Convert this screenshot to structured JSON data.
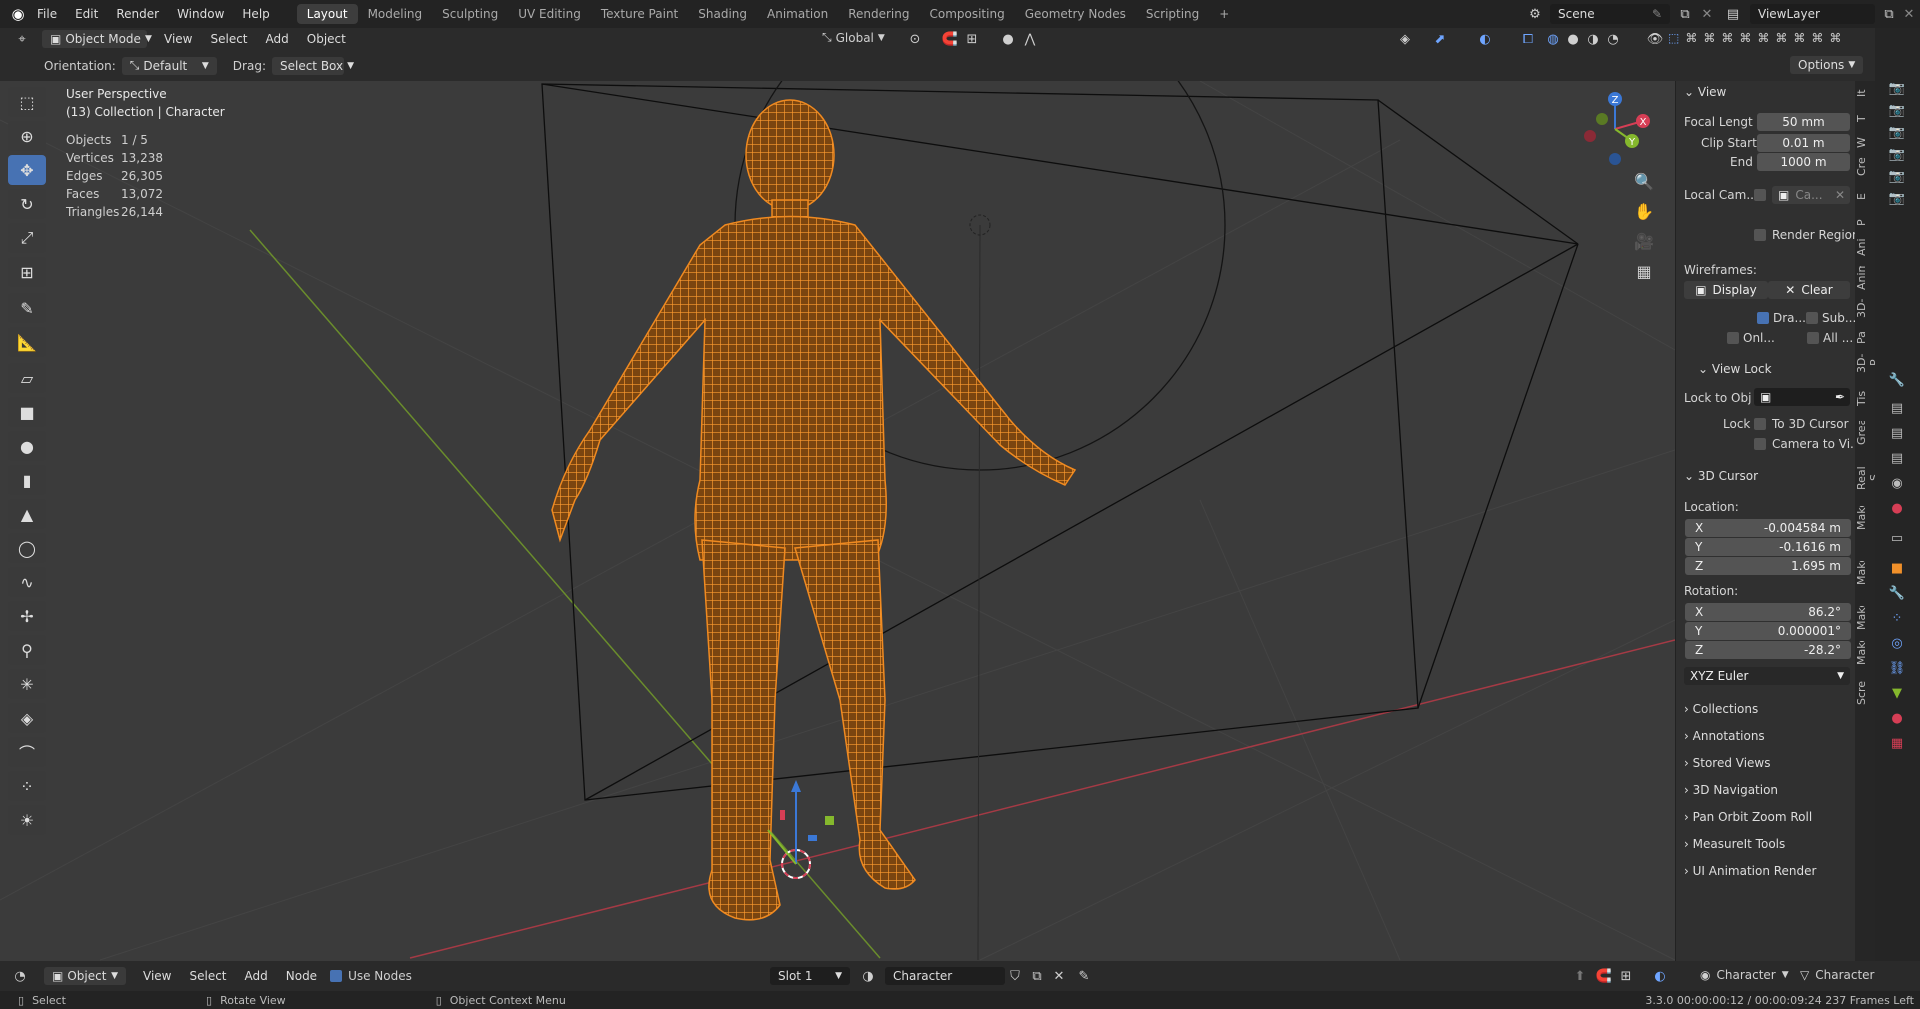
{
  "topbar": {
    "menus": [
      "File",
      "Edit",
      "Render",
      "Window",
      "Help"
    ],
    "workspaces": [
      "Layout",
      "Modeling",
      "Sculpting",
      "UV Editing",
      "Texture Paint",
      "Shading",
      "Animation",
      "Rendering",
      "Compositing",
      "Geometry Nodes",
      "Scripting"
    ],
    "add_tab": "+",
    "scene": "Scene",
    "view_layer": "ViewLayer"
  },
  "header": {
    "mode": "Object Mode",
    "menus": [
      "View",
      "Select",
      "Add",
      "Object"
    ],
    "transform_orientation": "Global",
    "options": "Options"
  },
  "tool_settings": {
    "orientation_label": "Orientation:",
    "orientation_value": "Default",
    "drag_label": "Drag:",
    "drag_value": "Select Box"
  },
  "hud": {
    "view_name": "User Perspective",
    "context": "(13) Collection | Character",
    "stats": [
      {
        "label": "Objects",
        "value": "1 / 5"
      },
      {
        "label": "Vertices",
        "value": "13,238"
      },
      {
        "label": "Edges",
        "value": "26,305"
      },
      {
        "label": "Faces",
        "value": "13,072"
      },
      {
        "label": "Triangles",
        "value": "26,144"
      }
    ]
  },
  "gizmo": {
    "x": "X",
    "y": "Y",
    "z": "Z"
  },
  "npanel": {
    "view_header": "View",
    "focal_label": "Focal Lengt",
    "focal_value": "50 mm",
    "clip_start_label": "Clip Start",
    "clip_start_value": "0.01 m",
    "clip_end_label": "End",
    "clip_end_value": "1000 m",
    "local_cam_label": "Local Cam...",
    "local_cam_value": "Ca...",
    "render_region": "Render Region",
    "wireframes_label": "Wireframes:",
    "display_btn": "Display",
    "clear_btn": "Clear",
    "cb_dra": "Dra...",
    "cb_sub": "Sub...",
    "cb_onl": "Onl...",
    "cb_all": "All ...",
    "view_lock_header": "View Lock",
    "lock_to_obj": "Lock to Obj",
    "lock_label": "Lock",
    "to_3d_cursor": "To 3D Cursor",
    "camera_to_view": "Camera to Vi...",
    "cursor_header": "3D Cursor",
    "location_label": "Location:",
    "loc": [
      {
        "axis": "X",
        "value": "-0.004584 m"
      },
      {
        "axis": "Y",
        "value": "-0.1616 m"
      },
      {
        "axis": "Z",
        "value": "1.695 m"
      }
    ],
    "rotation_label": "Rotation:",
    "rot": [
      {
        "axis": "X",
        "value": "86.2°"
      },
      {
        "axis": "Y",
        "value": "0.000001°"
      },
      {
        "axis": "Z",
        "value": "-28.2°"
      }
    ],
    "rotation_mode": "XYZ Euler",
    "collapsed": [
      "Collections",
      "Annotations",
      "Stored Views",
      "3D Navigation",
      "Pan Orbit Zoom Roll",
      "MeasureIt Tools",
      "UI Animation Render"
    ]
  },
  "vertical_tabs": [
    "It",
    "T",
    "W",
    "Cre",
    "E",
    "P",
    "Ani",
    "Anim",
    "3D-",
    "Pa",
    "3D-P",
    "Tis",
    "Grease",
    "Real S",
    "MakeClo",
    "MakeH",
    "Make",
    "MakeTa",
    "Screencas"
  ],
  "bottom_header": {
    "editor": "Object",
    "menus": [
      "View",
      "Select",
      "Add",
      "Node"
    ],
    "use_nodes": "Use Nodes",
    "slot": "Slot 1",
    "material": "Character",
    "object_name": "Character",
    "object_data": "Character"
  },
  "status": {
    "left": "Select",
    "middle": "Rotate View",
    "right": "Object Context Menu",
    "info": "3.3.0  00:00:00:12 / 00:00:09:24  237 Frames Left"
  },
  "colors": {
    "accent": "#4772b3",
    "wire": "#f0902a",
    "x_axis": "#d63e55",
    "y_axis": "#85b82d",
    "z_axis": "#3b78d6"
  }
}
